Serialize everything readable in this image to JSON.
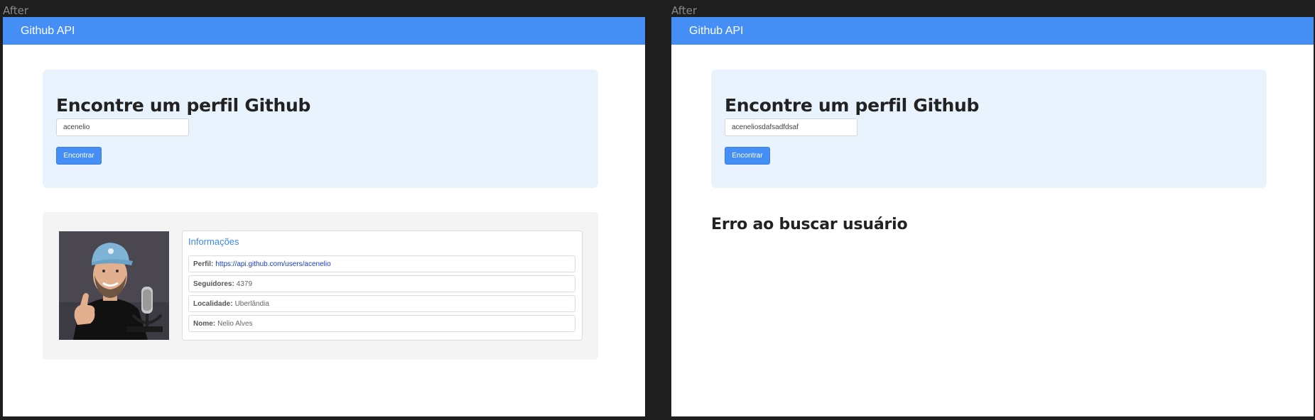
{
  "frames": [
    {
      "label": "After",
      "nav_title": "Github API",
      "search": {
        "title": "Encontre um perfil Github",
        "input_value": "acenelio",
        "button_label": "Encontrar"
      },
      "result": {
        "info_title": "Informações",
        "fields": [
          {
            "label": "Perfil:",
            "value": "https://api.github.com/users/acenelio",
            "is_link": true
          },
          {
            "label": "Seguidores:",
            "value": "4379"
          },
          {
            "label": "Localidade:",
            "value": "Uberlândia"
          },
          {
            "label": "Nome:",
            "value": "Nelio Alves"
          }
        ]
      }
    },
    {
      "label": "After",
      "nav_title": "Github API",
      "search": {
        "title": "Encontre um perfil Github",
        "input_value": "aceneliosdafsadfdsaf",
        "button_label": "Encontrar"
      },
      "error_message": "Erro ao buscar usuário"
    }
  ],
  "colors": {
    "navbar": "#448ef5",
    "search_card_bg": "#e8f3fd",
    "result_card_bg": "#f4f4f4",
    "link": "#1a3cc8",
    "info_title": "#3b88ea"
  }
}
